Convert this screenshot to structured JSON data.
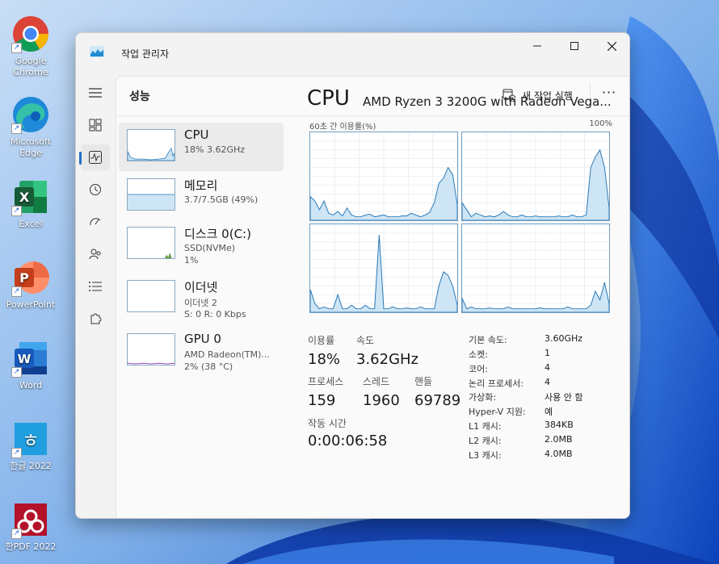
{
  "desktop": {
    "icons": [
      {
        "label": "Google Chrome",
        "name": "chrome"
      },
      {
        "label": "Microsoft Edge",
        "name": "edge"
      },
      {
        "label": "Excel",
        "name": "excel"
      },
      {
        "label": "PowerPoint",
        "name": "powerpoint"
      },
      {
        "label": "Word",
        "name": "word"
      },
      {
        "label": "한글 2022",
        "name": "hangul"
      },
      {
        "label": "한PDF 2022",
        "name": "hanpdf"
      }
    ]
  },
  "window": {
    "title": "작업 관리자",
    "page_title": "성능",
    "run_task_label": "새 작업 실행",
    "more_label": "···"
  },
  "resources": [
    {
      "title": "CPU",
      "sub1": "18% 3.62GHz",
      "sub2": ""
    },
    {
      "title": "메모리",
      "sub1": "3.7/7.5GB (49%)",
      "sub2": ""
    },
    {
      "title": "디스크 0(C:)",
      "sub1": "SSD(NVMe)",
      "sub2": "1%"
    },
    {
      "title": "이더넷",
      "sub1": "이더넷 2",
      "sub2": "S: 0 R: 0 Kbps"
    },
    {
      "title": "GPU 0",
      "sub1": "AMD Radeon(TM)...",
      "sub2": "2% (38 °C)"
    }
  ],
  "detail": {
    "heading": "CPU",
    "model": "AMD Ryzen 3 3200G with Radeon Vega...",
    "graph_label": "60초 간 이용률(%)",
    "graph_max": "100%",
    "stats": {
      "utilization_label": "이용률",
      "utilization": "18%",
      "speed_label": "속도",
      "speed": "3.62GHz",
      "processes_label": "프로세스",
      "processes": "159",
      "threads_label": "스레드",
      "threads": "1960",
      "handles_label": "핸들",
      "handles": "69789",
      "uptime_label": "작동 시간",
      "uptime": "0:00:06:58"
    },
    "specs": [
      {
        "k": "기본 속도:",
        "v": "3.60GHz"
      },
      {
        "k": "소켓:",
        "v": "1"
      },
      {
        "k": "코어:",
        "v": "4"
      },
      {
        "k": "논리 프로세서:",
        "v": "4"
      },
      {
        "k": "가상화:",
        "v": "사용 안 함"
      },
      {
        "k": "Hyper-V 지원:",
        "v": "예"
      },
      {
        "k": "L1 캐시:",
        "v": "384KB"
      },
      {
        "k": "L2 캐시:",
        "v": "2.0MB"
      },
      {
        "k": "L3 캐시:",
        "v": "4.0MB"
      }
    ],
    "core_graphs": [
      [
        27,
        22,
        12,
        22,
        8,
        6,
        10,
        5,
        14,
        6,
        4,
        4,
        6,
        7,
        4,
        5,
        6,
        4,
        4,
        4,
        5,
        5,
        8,
        6,
        4,
        6,
        9,
        20,
        42,
        48,
        60,
        52,
        18
      ],
      [
        20,
        12,
        4,
        8,
        6,
        4,
        5,
        4,
        6,
        10,
        6,
        4,
        4,
        6,
        4,
        4,
        5,
        4,
        4,
        4,
        4,
        5,
        4,
        4,
        6,
        4,
        4,
        6,
        60,
        72,
        80,
        60,
        14
      ],
      [
        26,
        10,
        4,
        6,
        4,
        4,
        20,
        4,
        4,
        8,
        4,
        4,
        8,
        4,
        4,
        88,
        4,
        4,
        6,
        4,
        4,
        5,
        4,
        4,
        6,
        4,
        4,
        4,
        30,
        46,
        42,
        30,
        8
      ],
      [
        16,
        4,
        6,
        4,
        4,
        4,
        5,
        4,
        4,
        4,
        6,
        4,
        4,
        4,
        4,
        4,
        4,
        5,
        4,
        4,
        4,
        4,
        4,
        6,
        4,
        4,
        4,
        4,
        8,
        24,
        14,
        34,
        10
      ]
    ]
  },
  "colors": {
    "accent": "#1f6fc5",
    "graph_line": "#2a78b5",
    "graph_fill": "#cde5f5",
    "grid": "#dfe9f1"
  }
}
